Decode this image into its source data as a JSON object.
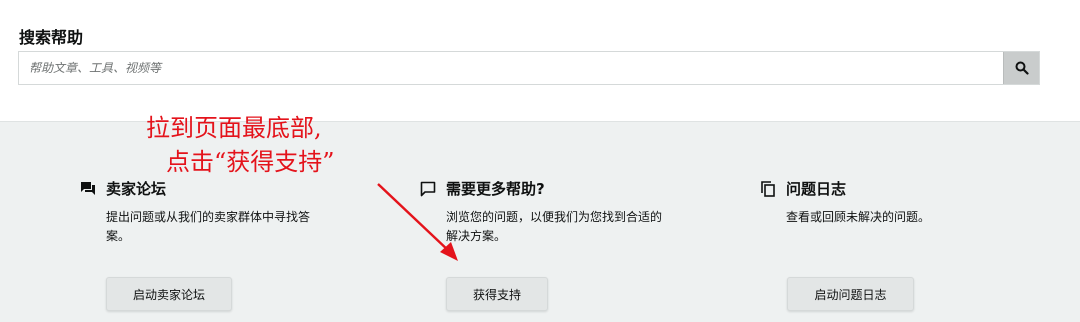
{
  "search": {
    "title": "搜索帮助",
    "placeholder": "帮助文章、工具、视频等",
    "button_icon": "search-icon"
  },
  "sections": [
    {
      "icon": "forum-icon",
      "title": "卖家论坛",
      "desc": "提出问题或从我们的卖家群体中寻找答案。",
      "button": "启动卖家论坛"
    },
    {
      "icon": "chat-bubble-icon",
      "title": "需要更多帮助?",
      "desc": "浏览您的问题，以便我们为您找到合适的解决方案。",
      "button": "获得支持"
    },
    {
      "icon": "copy-icon",
      "title": "问题日志",
      "desc": "查看或回顾未解决的问题。",
      "button": "启动问题日志"
    }
  ],
  "annotation": {
    "line1": "拉到页面最底部,",
    "line2": "点击“获得支持”",
    "color": "#e4131b"
  },
  "colors": {
    "panel_bg": "#eef1f1",
    "button_bg": "#e3e6e6",
    "search_button_bg": "#c9cccc"
  }
}
